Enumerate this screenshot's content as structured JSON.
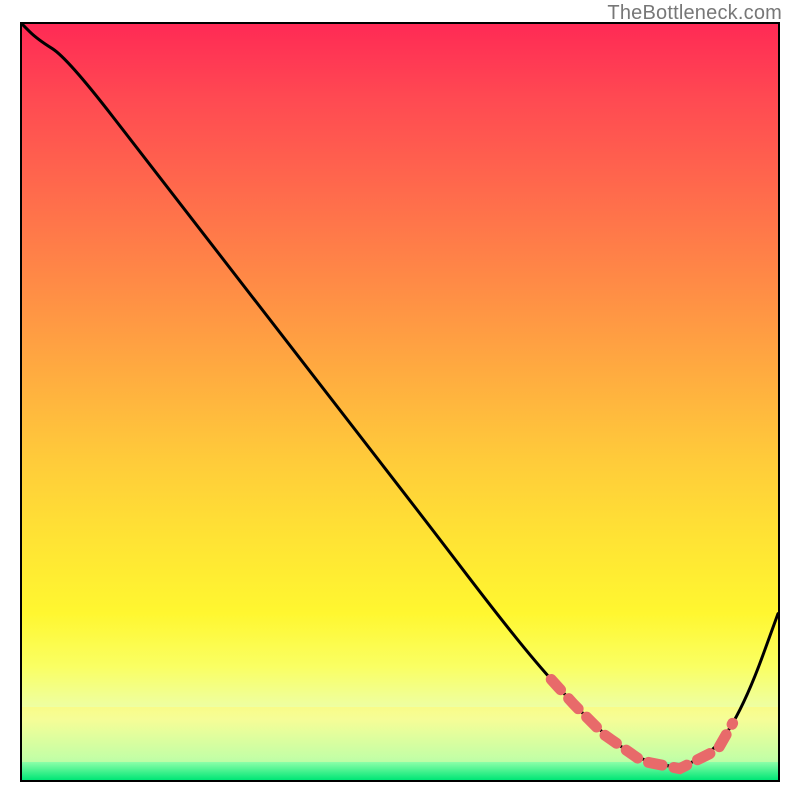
{
  "attribution": "TheBottleneck.com",
  "chart_data": {
    "type": "line",
    "title": "",
    "xlabel": "",
    "ylabel": "",
    "xlim": [
      0,
      100
    ],
    "ylim": [
      0,
      100
    ],
    "x": [
      0,
      2,
      6,
      18,
      30,
      42,
      54,
      62,
      68,
      73,
      77,
      82,
      87,
      92,
      96,
      100
    ],
    "values": [
      100,
      98,
      95.5,
      80,
      64.5,
      49,
      33.5,
      23,
      15.5,
      10,
      6,
      2.5,
      1.5,
      4,
      11,
      22
    ],
    "highlight_range_x": [
      70,
      94
    ],
    "gradient_colors_top_to_bottom": [
      "#ff2a55",
      "#ff6a4c",
      "#ffcc3a",
      "#fff730",
      "#00e676"
    ]
  }
}
